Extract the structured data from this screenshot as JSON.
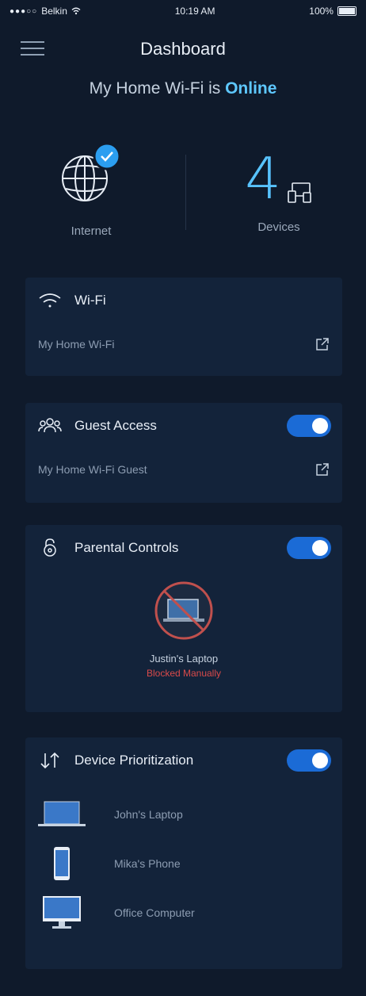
{
  "status_bar": {
    "carrier": "Belkin",
    "time": "10:19 AM",
    "battery": "100%"
  },
  "nav": {
    "title": "Dashboard"
  },
  "network": {
    "prefix": "My Home Wi-Fi is",
    "status": "Online"
  },
  "summary": {
    "internet_label": "Internet",
    "device_count": "4",
    "devices_label": "Devices"
  },
  "wifi": {
    "title": "Wi-Fi",
    "network_name": "My Home Wi-Fi"
  },
  "guest": {
    "title": "Guest Access",
    "enabled": true,
    "network_name": "My Home Wi-Fi Guest"
  },
  "parental": {
    "title": "Parental Controls",
    "enabled": true,
    "device_name": "Justin's Laptop",
    "device_status": "Blocked Manually"
  },
  "prioritization": {
    "title": "Device Prioritization",
    "enabled": true,
    "devices": [
      {
        "name": "John's Laptop",
        "icon": "laptop-icon"
      },
      {
        "name": "Mika's Phone",
        "icon": "phone-icon"
      },
      {
        "name": "Office Computer",
        "icon": "desktop-icon"
      }
    ]
  },
  "colors": {
    "accent": "#58c3ff",
    "toggle_on": "#1b6bd6",
    "blocked": "#d94a4a",
    "background": "#0f1a2b",
    "card": "#13233a"
  }
}
